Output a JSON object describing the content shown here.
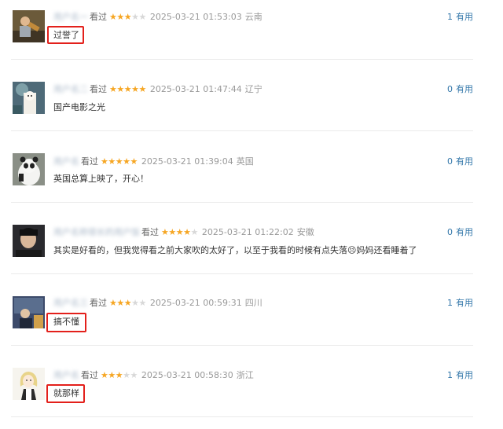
{
  "vote_label": "有用",
  "reviews": [
    {
      "username": "用户名一",
      "watched": "看过",
      "rating": 3,
      "time": "2025-03-21 01:53:03",
      "location": "云南",
      "votes": "1",
      "comment": "过誉了",
      "highlighted": true
    },
    {
      "username": "用户名二",
      "watched": "看过",
      "rating": 5,
      "time": "2025-03-21 01:47:44",
      "location": "辽宁",
      "votes": "0",
      "comment": "国产电影之光",
      "highlighted": false
    },
    {
      "username": "用户名",
      "watched": "看过",
      "rating": 5,
      "time": "2025-03-21 01:39:04",
      "location": "英国",
      "votes": "0",
      "comment": "英国总算上映了，开心！",
      "highlighted": false
    },
    {
      "username": "用户名称很长的用户饭",
      "watched": "看过",
      "rating": 4,
      "time": "2025-03-21 01:22:02",
      "location": "安徽",
      "votes": "0",
      "comment": "其实是好看的，但我觉得看之前大家吹的太好了，以至于我看的时候有点失落😣妈妈还看睡着了",
      "highlighted": false
    },
    {
      "username": "用户名三",
      "watched": "看过",
      "rating": 3,
      "time": "2025-03-21 00:59:31",
      "location": "四川",
      "votes": "1",
      "comment": "搞不懂",
      "highlighted": true
    },
    {
      "username": "用户名",
      "watched": "看过",
      "rating": 3,
      "time": "2025-03-21 00:58:30",
      "location": "浙江",
      "votes": "1",
      "comment": "就那样",
      "highlighted": true
    }
  ]
}
